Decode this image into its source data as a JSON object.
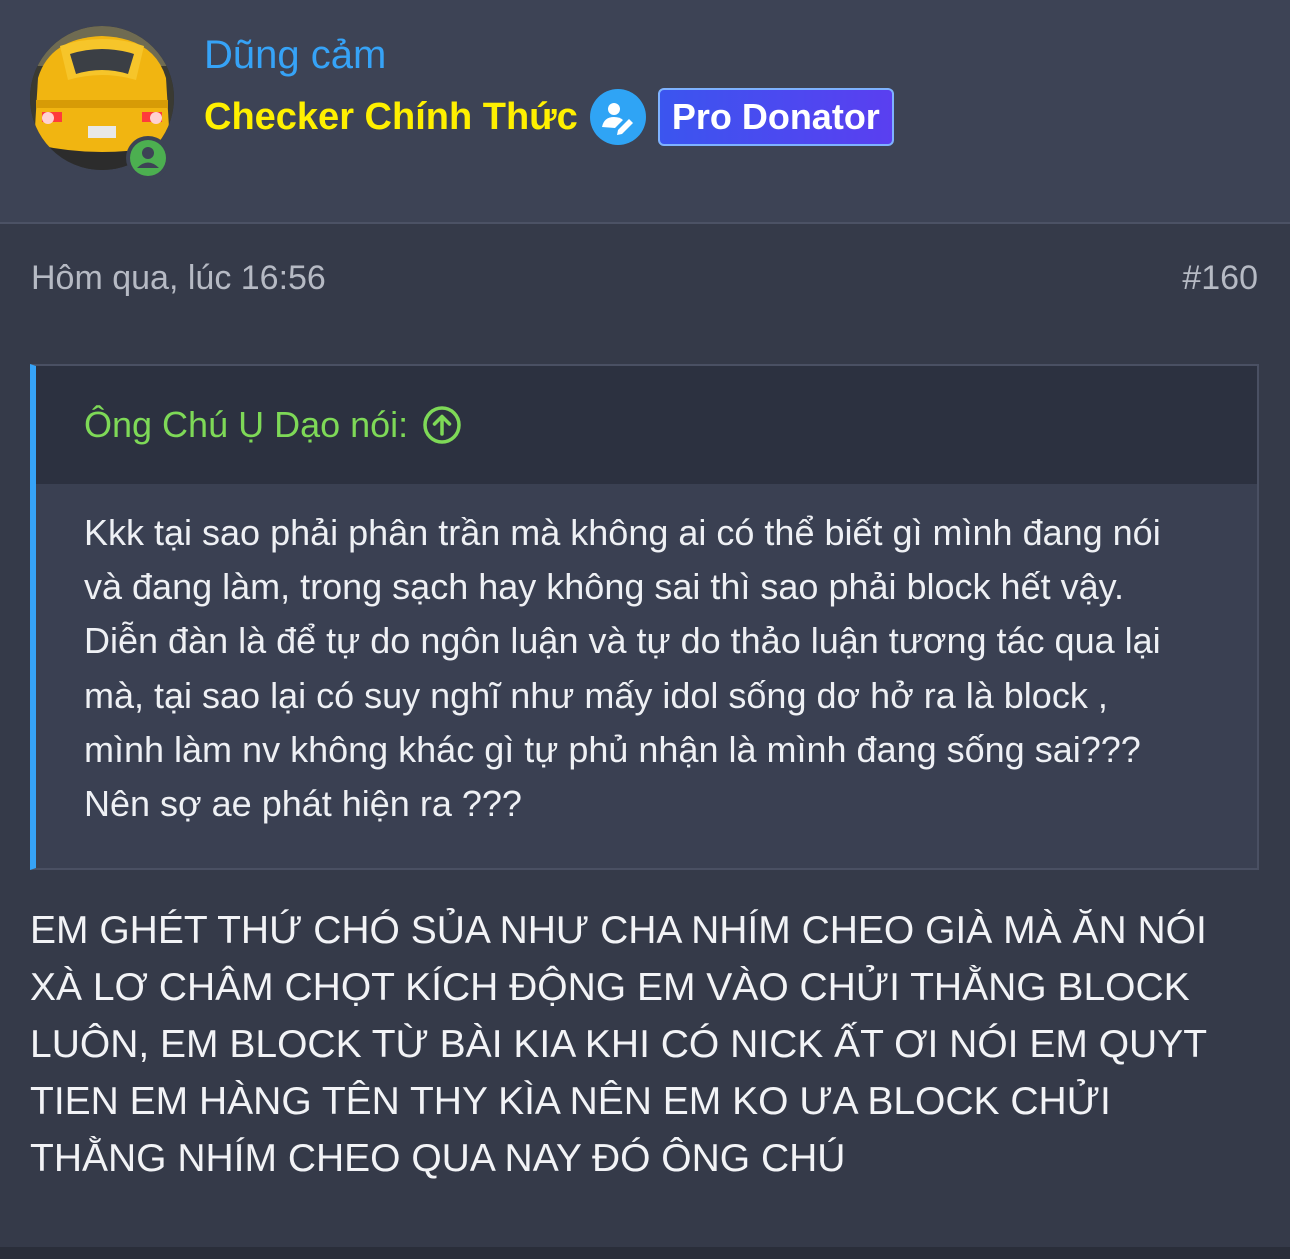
{
  "user": {
    "name": "Dũng cảm",
    "title": "Checker Chính Thức",
    "badge": "Pro Donator"
  },
  "post": {
    "date": "Hôm qua, lúc 16:56",
    "number": "#160",
    "quote": {
      "author": "Ông Chú Ụ Dạo nói:",
      "text": "Kkk tại sao phải phân trần mà không ai có thể biết gì mình đang nói và đang làm, trong sạch hay không sai thì sao phải block hết vậy. Diễn đàn là để tự do ngôn luận và tự do thảo luận tương tác qua lại mà, tại sao lại có suy nghĩ như mấy idol sống dơ hở ra là block , mình làm nv không khác gì tự phủ nhận là mình đang sống sai??? Nên sợ ae phát hiện ra ???"
    },
    "message": "EM GHÉT THỨ CHÓ SỦA NHƯ CHA NHÍM CHEO GIÀ MÀ ĂN NÓI XÀ LƠ CHÂM CHỌT KÍCH ĐỘNG EM VÀO CHỬI THẰNG BLOCK LUÔN, EM BLOCK TỪ BÀI KIA KHI CÓ NICK ẤT ƠI NÓI EM QUYT TIEN EM HÀNG TÊN THY KÌA NÊN EM KO ƯA BLOCK CHỬI THẰNG NHÍM CHEO QUA NAY ĐÓ ÔNG CHÚ"
  },
  "colors": {
    "username": "#36a3f7",
    "title": "#fff000",
    "quote_author": "#7ed957",
    "online": "#4caf50"
  },
  "icons": {
    "online": "user-online-icon",
    "checker": "user-edit-icon",
    "quote_jump": "arrow-up-circle-icon"
  }
}
